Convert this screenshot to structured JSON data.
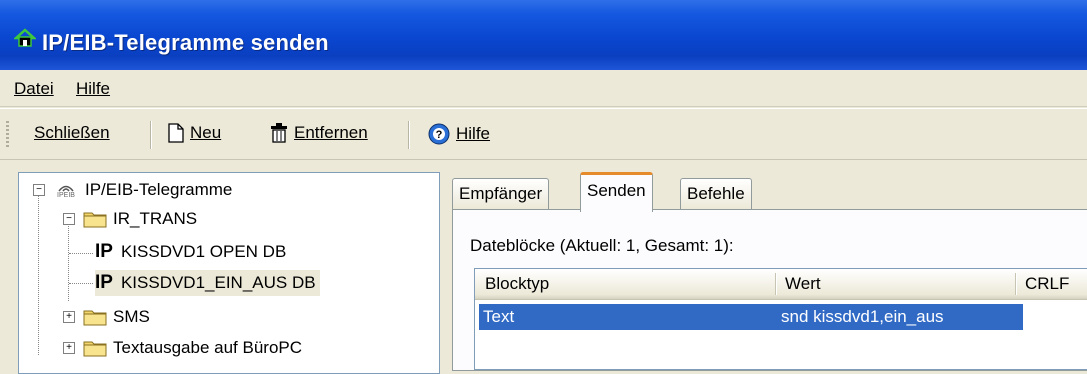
{
  "window": {
    "title": "IP/EIB-Telegramme senden"
  },
  "menu": {
    "items": [
      "Datei",
      "Hilfe"
    ]
  },
  "toolbar": {
    "close_label": "Schließen",
    "new_label": "Neu",
    "remove_label": "Entfernen",
    "help_label": "Hilfe"
  },
  "tree": {
    "root": "IP/EIB-Telegramme",
    "root_icon_text": "IPEIB",
    "folder_ir": "IR_TRANS",
    "items": [
      "KISSDVD1 OPEN DB",
      "KISSDVD1_EIN_AUS DB"
    ],
    "ip_badge": "IP",
    "folder_sms": "SMS",
    "folder_text": "Textausgabe auf BüroPC"
  },
  "tabs": [
    "Empfänger",
    "Senden",
    "Befehle"
  ],
  "panel": {
    "blocks_label": "Dateblöcke (Aktuell: 1, Gesamt: 1):"
  },
  "grid": {
    "columns": [
      "Blocktyp",
      "Wert",
      "CRLF"
    ],
    "rows": [
      {
        "blocktyp": "Text",
        "wert": "snd kissdvd1,ein_aus"
      }
    ]
  },
  "colors": {
    "titlebar": "#0a46d0",
    "selection": "#316ac5",
    "tab_accent": "#e68b2c"
  }
}
